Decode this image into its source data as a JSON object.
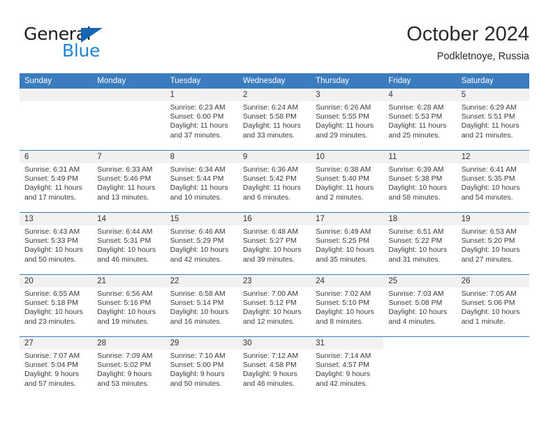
{
  "brand": {
    "line1": "General",
    "line2": "Blue",
    "triangle_icon": "blue-triangle-icon",
    "color_dark": "#1b1b1b",
    "color_blue": "#2083d6"
  },
  "header": {
    "title": "October 2024",
    "subtitle": "Podkletnoye, Russia"
  },
  "theme": {
    "header_blue": "#3a7cbd",
    "band_gray": "#f1f1f1",
    "text": "#3a3a3a"
  },
  "calendar": {
    "weekday_headers": [
      "Sunday",
      "Monday",
      "Tuesday",
      "Wednesday",
      "Thursday",
      "Friday",
      "Saturday"
    ],
    "weeks": [
      [
        {
          "day": "",
          "empty": true
        },
        {
          "day": "",
          "empty": true
        },
        {
          "day": "1",
          "sunrise": "Sunrise: 6:23 AM",
          "sunset": "Sunset: 6:00 PM",
          "daylight1": "Daylight: 11 hours",
          "daylight2": "and 37 minutes."
        },
        {
          "day": "2",
          "sunrise": "Sunrise: 6:24 AM",
          "sunset": "Sunset: 5:58 PM",
          "daylight1": "Daylight: 11 hours",
          "daylight2": "and 33 minutes."
        },
        {
          "day": "3",
          "sunrise": "Sunrise: 6:26 AM",
          "sunset": "Sunset: 5:55 PM",
          "daylight1": "Daylight: 11 hours",
          "daylight2": "and 29 minutes."
        },
        {
          "day": "4",
          "sunrise": "Sunrise: 6:28 AM",
          "sunset": "Sunset: 5:53 PM",
          "daylight1": "Daylight: 11 hours",
          "daylight2": "and 25 minutes."
        },
        {
          "day": "5",
          "sunrise": "Sunrise: 6:29 AM",
          "sunset": "Sunset: 5:51 PM",
          "daylight1": "Daylight: 11 hours",
          "daylight2": "and 21 minutes."
        }
      ],
      [
        {
          "day": "6",
          "sunrise": "Sunrise: 6:31 AM",
          "sunset": "Sunset: 5:49 PM",
          "daylight1": "Daylight: 11 hours",
          "daylight2": "and 17 minutes."
        },
        {
          "day": "7",
          "sunrise": "Sunrise: 6:33 AM",
          "sunset": "Sunset: 5:46 PM",
          "daylight1": "Daylight: 11 hours",
          "daylight2": "and 13 minutes."
        },
        {
          "day": "8",
          "sunrise": "Sunrise: 6:34 AM",
          "sunset": "Sunset: 5:44 PM",
          "daylight1": "Daylight: 11 hours",
          "daylight2": "and 10 minutes."
        },
        {
          "day": "9",
          "sunrise": "Sunrise: 6:36 AM",
          "sunset": "Sunset: 5:42 PM",
          "daylight1": "Daylight: 11 hours",
          "daylight2": "and 6 minutes."
        },
        {
          "day": "10",
          "sunrise": "Sunrise: 6:38 AM",
          "sunset": "Sunset: 5:40 PM",
          "daylight1": "Daylight: 11 hours",
          "daylight2": "and 2 minutes."
        },
        {
          "day": "11",
          "sunrise": "Sunrise: 6:39 AM",
          "sunset": "Sunset: 5:38 PM",
          "daylight1": "Daylight: 10 hours",
          "daylight2": "and 58 minutes."
        },
        {
          "day": "12",
          "sunrise": "Sunrise: 6:41 AM",
          "sunset": "Sunset: 5:35 PM",
          "daylight1": "Daylight: 10 hours",
          "daylight2": "and 54 minutes."
        }
      ],
      [
        {
          "day": "13",
          "sunrise": "Sunrise: 6:43 AM",
          "sunset": "Sunset: 5:33 PM",
          "daylight1": "Daylight: 10 hours",
          "daylight2": "and 50 minutes."
        },
        {
          "day": "14",
          "sunrise": "Sunrise: 6:44 AM",
          "sunset": "Sunset: 5:31 PM",
          "daylight1": "Daylight: 10 hours",
          "daylight2": "and 46 minutes."
        },
        {
          "day": "15",
          "sunrise": "Sunrise: 6:46 AM",
          "sunset": "Sunset: 5:29 PM",
          "daylight1": "Daylight: 10 hours",
          "daylight2": "and 42 minutes."
        },
        {
          "day": "16",
          "sunrise": "Sunrise: 6:48 AM",
          "sunset": "Sunset: 5:27 PM",
          "daylight1": "Daylight: 10 hours",
          "daylight2": "and 39 minutes."
        },
        {
          "day": "17",
          "sunrise": "Sunrise: 6:49 AM",
          "sunset": "Sunset: 5:25 PM",
          "daylight1": "Daylight: 10 hours",
          "daylight2": "and 35 minutes."
        },
        {
          "day": "18",
          "sunrise": "Sunrise: 6:51 AM",
          "sunset": "Sunset: 5:22 PM",
          "daylight1": "Daylight: 10 hours",
          "daylight2": "and 31 minutes."
        },
        {
          "day": "19",
          "sunrise": "Sunrise: 6:53 AM",
          "sunset": "Sunset: 5:20 PM",
          "daylight1": "Daylight: 10 hours",
          "daylight2": "and 27 minutes."
        }
      ],
      [
        {
          "day": "20",
          "sunrise": "Sunrise: 6:55 AM",
          "sunset": "Sunset: 5:18 PM",
          "daylight1": "Daylight: 10 hours",
          "daylight2": "and 23 minutes."
        },
        {
          "day": "21",
          "sunrise": "Sunrise: 6:56 AM",
          "sunset": "Sunset: 5:16 PM",
          "daylight1": "Daylight: 10 hours",
          "daylight2": "and 19 minutes."
        },
        {
          "day": "22",
          "sunrise": "Sunrise: 6:58 AM",
          "sunset": "Sunset: 5:14 PM",
          "daylight1": "Daylight: 10 hours",
          "daylight2": "and 16 minutes."
        },
        {
          "day": "23",
          "sunrise": "Sunrise: 7:00 AM",
          "sunset": "Sunset: 5:12 PM",
          "daylight1": "Daylight: 10 hours",
          "daylight2": "and 12 minutes."
        },
        {
          "day": "24",
          "sunrise": "Sunrise: 7:02 AM",
          "sunset": "Sunset: 5:10 PM",
          "daylight1": "Daylight: 10 hours",
          "daylight2": "and 8 minutes."
        },
        {
          "day": "25",
          "sunrise": "Sunrise: 7:03 AM",
          "sunset": "Sunset: 5:08 PM",
          "daylight1": "Daylight: 10 hours",
          "daylight2": "and 4 minutes."
        },
        {
          "day": "26",
          "sunrise": "Sunrise: 7:05 AM",
          "sunset": "Sunset: 5:06 PM",
          "daylight1": "Daylight: 10 hours",
          "daylight2": "and 1 minute."
        }
      ],
      [
        {
          "day": "27",
          "sunrise": "Sunrise: 7:07 AM",
          "sunset": "Sunset: 5:04 PM",
          "daylight1": "Daylight: 9 hours",
          "daylight2": "and 57 minutes."
        },
        {
          "day": "28",
          "sunrise": "Sunrise: 7:09 AM",
          "sunset": "Sunset: 5:02 PM",
          "daylight1": "Daylight: 9 hours",
          "daylight2": "and 53 minutes."
        },
        {
          "day": "29",
          "sunrise": "Sunrise: 7:10 AM",
          "sunset": "Sunset: 5:00 PM",
          "daylight1": "Daylight: 9 hours",
          "daylight2": "and 50 minutes."
        },
        {
          "day": "30",
          "sunrise": "Sunrise: 7:12 AM",
          "sunset": "Sunset: 4:58 PM",
          "daylight1": "Daylight: 9 hours",
          "daylight2": "and 46 minutes."
        },
        {
          "day": "31",
          "sunrise": "Sunrise: 7:14 AM",
          "sunset": "Sunset: 4:57 PM",
          "daylight1": "Daylight: 9 hours",
          "daylight2": "and 42 minutes."
        },
        {
          "day": "",
          "empty": true,
          "blank": true
        },
        {
          "day": "",
          "empty": true,
          "blank": true
        }
      ]
    ]
  }
}
